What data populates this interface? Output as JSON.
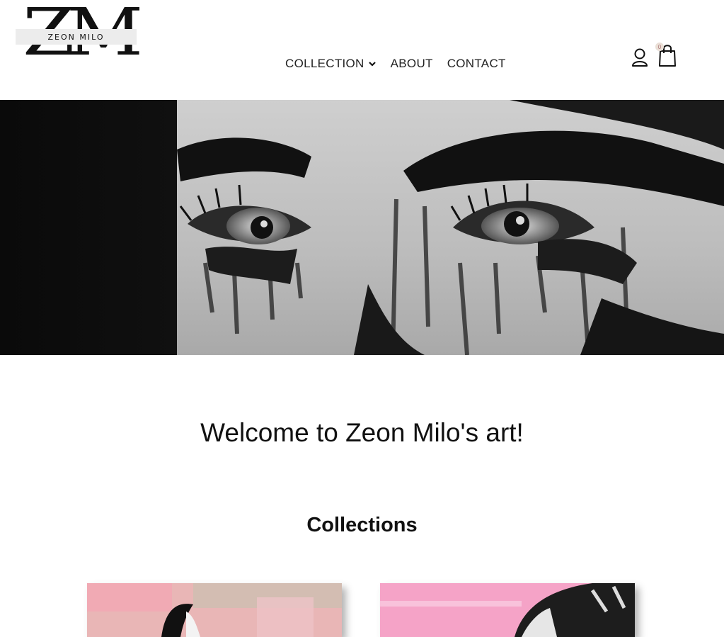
{
  "logo": {
    "letters": "ZM",
    "name": "ZEON MILO"
  },
  "nav": {
    "items": [
      {
        "label": "COLLECTION",
        "has_dropdown": true
      },
      {
        "label": "ABOUT"
      },
      {
        "label": "CONTACT"
      }
    ]
  },
  "cart": {
    "count": "0"
  },
  "icons": {
    "account": "user-icon",
    "cart": "shopping-bag-icon",
    "dropdown": "chevron-down-icon"
  },
  "hero": {
    "image": "black-and-white painted eyes artwork"
  },
  "main": {
    "welcome": "Welcome to Zeon Milo's art!",
    "collections_title": "Collections"
  },
  "collections": [
    {
      "image": "pink abstract painting with black figure"
    },
    {
      "image": "pink painting with black brushstrokes"
    }
  ],
  "colors": {
    "text": "#111111",
    "badge": "#eadfd6",
    "background": "#ffffff"
  }
}
